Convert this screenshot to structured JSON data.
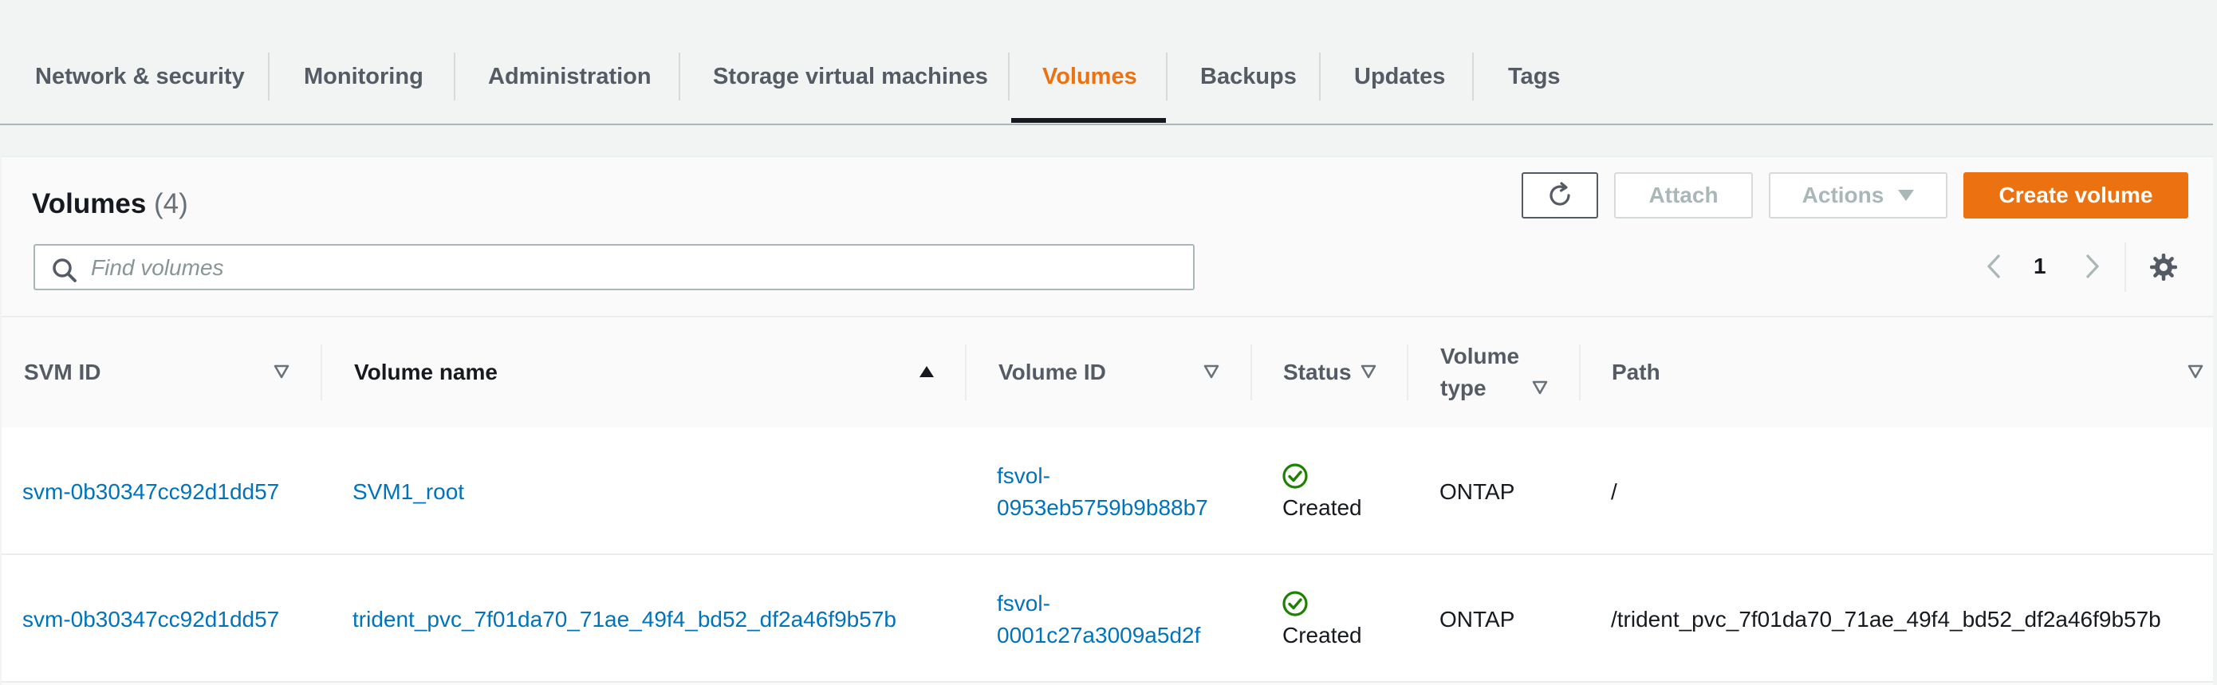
{
  "tabs": [
    {
      "label": "Network & security"
    },
    {
      "label": "Monitoring"
    },
    {
      "label": "Administration"
    },
    {
      "label": "Storage virtual machines"
    },
    {
      "label": "Volumes"
    },
    {
      "label": "Backups"
    },
    {
      "label": "Updates"
    },
    {
      "label": "Tags"
    }
  ],
  "active_tab": "Volumes",
  "accent_color": "#ec7211",
  "link_color": "#0073bb",
  "panel": {
    "title": "Volumes",
    "count": "(4)",
    "attach_label": "Attach",
    "actions_label": "Actions",
    "create_label": "Create volume",
    "refresh_icon": "refresh-icon",
    "search_placeholder": "Find volumes",
    "search_value": "",
    "page": "1"
  },
  "table": {
    "columns": [
      {
        "label": "SVM ID"
      },
      {
        "label": "Volume name"
      },
      {
        "label": "Volume ID"
      },
      {
        "label": "Status"
      },
      {
        "label": "Volume type"
      },
      {
        "label": "Path"
      }
    ],
    "sorted_column": "Volume name",
    "sort_direction": "ascending",
    "rows": [
      {
        "svm_id": "svm-0b30347cc92d1dd57",
        "volume_name": "SVM1_root",
        "volume_id_line1": "fsvol-",
        "volume_id_line2": "0953eb5759b9b88b7",
        "status": "Created",
        "volume_type": "ONTAP",
        "path": "/"
      },
      {
        "svm_id": "svm-0b30347cc92d1dd57",
        "volume_name": "trident_pvc_7f01da70_71ae_49f4_bd52_df2a46f9b57b",
        "volume_id_line1": "fsvol-",
        "volume_id_line2": "0001c27a3009a5d2f",
        "status": "Created",
        "volume_type": "ONTAP",
        "path": "/trident_pvc_7f01da70_71ae_49f4_bd52_df2a46f9b57b"
      }
    ]
  }
}
